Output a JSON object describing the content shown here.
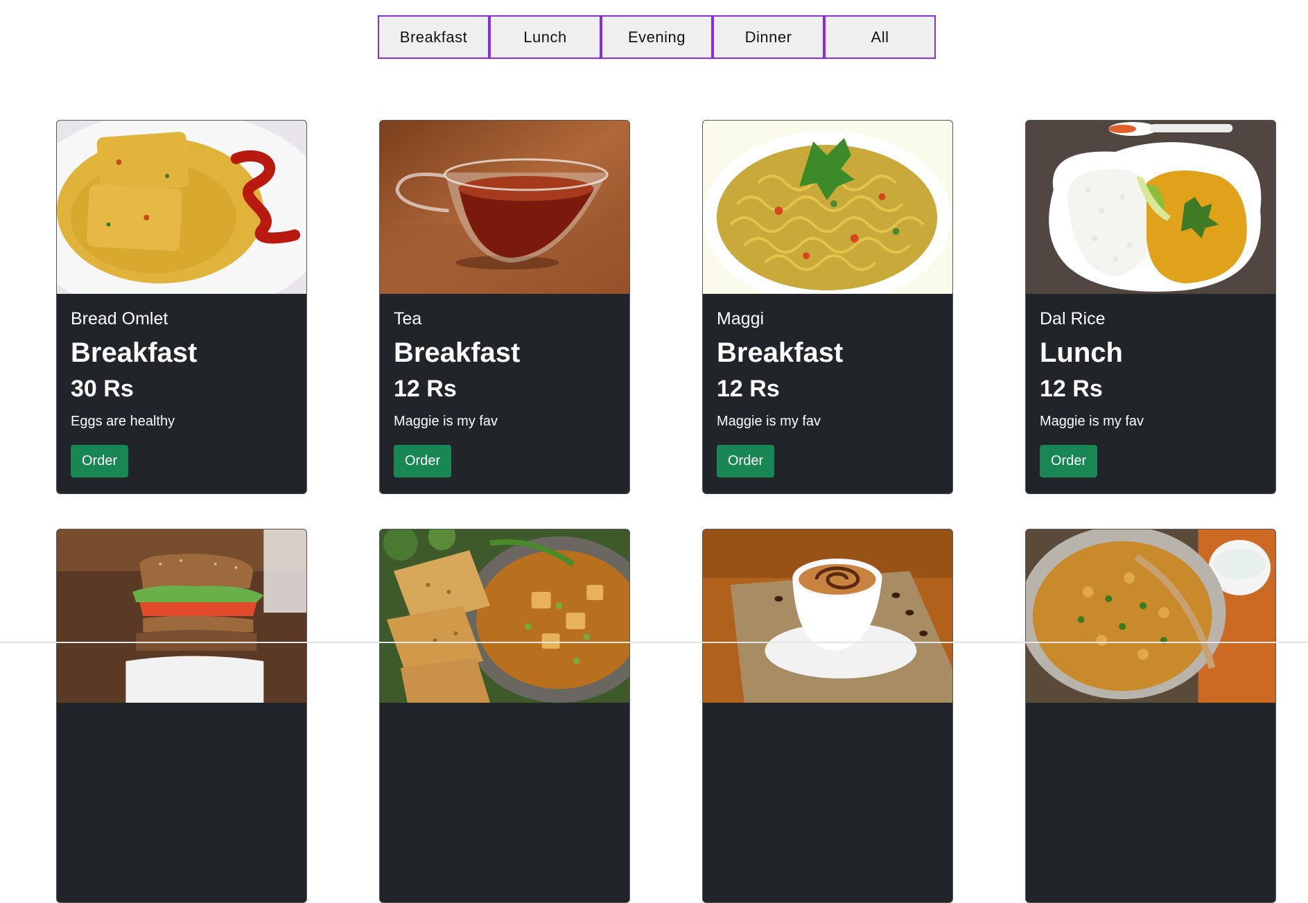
{
  "filters": [
    "Breakfast",
    "Lunch",
    "Evening",
    "Dinner",
    "All"
  ],
  "order_label": "Order",
  "cards": [
    {
      "title": "Bread Omlet",
      "category": "Breakfast",
      "price": "30 Rs",
      "desc": "Eggs are healthy",
      "image": "bread-omlet-image"
    },
    {
      "title": "Tea",
      "category": "Breakfast",
      "price": "12 Rs",
      "desc": "Maggie is my fav",
      "image": "tea-image"
    },
    {
      "title": "Maggi",
      "category": "Breakfast",
      "price": "12 Rs",
      "desc": "Maggie is my fav",
      "image": "maggi-image"
    },
    {
      "title": "Dal Rice",
      "category": "Lunch",
      "price": "12 Rs",
      "desc": "Maggie is my fav",
      "image": "dal-rice-image"
    },
    {
      "title": "",
      "category": "",
      "price": "",
      "desc": "",
      "image": "sandwich-image"
    },
    {
      "title": "",
      "category": "",
      "price": "",
      "desc": "",
      "image": "paratha-curry-image"
    },
    {
      "title": "",
      "category": "",
      "price": "",
      "desc": "",
      "image": "coffee-image"
    },
    {
      "title": "",
      "category": "",
      "price": "",
      "desc": "",
      "image": "biryani-image"
    }
  ],
  "colors": {
    "filter_border": "#8a2be2",
    "card_bg": "#212529",
    "order_button": "#198754"
  }
}
